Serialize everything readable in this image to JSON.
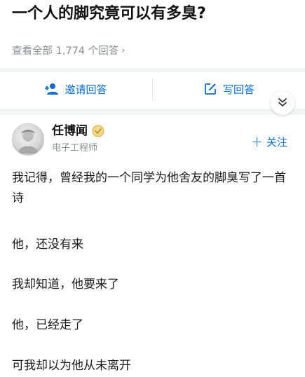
{
  "question": {
    "title": "一个人的脚究竟可以有多臭?",
    "view_all": "查看全部 1,774 个回答",
    "view_all_chevron": "›"
  },
  "actions": {
    "invite": "邀请回答",
    "write": "写回答",
    "invite_icon": "add-user-icon",
    "write_icon": "edit-icon"
  },
  "author": {
    "name": "任博闻",
    "title": "电子工程师",
    "badge_icon": "verified-badge-icon",
    "follow_label": "关注",
    "follow_plus": "+"
  },
  "answer": {
    "paragraphs": [
      "我记得，曾经我的一个同学为他舍友的脚臭写了一首诗",
      "他，还没有来",
      "我却知道，他要来了",
      "他，已经走了",
      "可我却以为他从未离开"
    ]
  },
  "colors": {
    "accent": "#0a6dd1",
    "muted_text": "#8a8f99",
    "band": "#f3f4f6"
  }
}
